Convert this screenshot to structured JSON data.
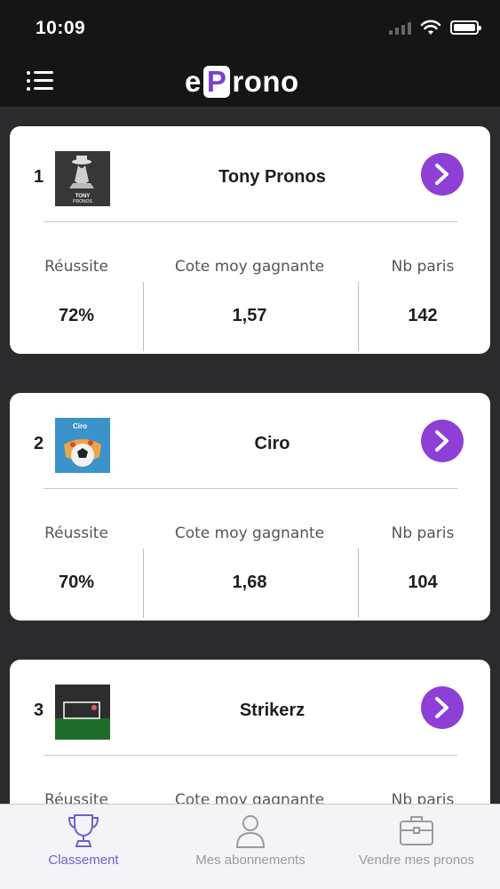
{
  "status_bar": {
    "time": "10:09"
  },
  "header": {
    "logo_prefix": "e",
    "logo_highlight": "P",
    "logo_suffix": "rono",
    "accent_color": "#7d3fd0"
  },
  "ranking": {
    "labels": {
      "success": "Réussite",
      "avg_odds": "Cote moy gagnante",
      "bets_count": "Nb paris"
    },
    "entries": [
      {
        "rank": "1",
        "name": "Tony Pronos",
        "success": "72%",
        "avg_odds": "1,57",
        "bets_count": "142",
        "avatar_text": "TONY PRONOS"
      },
      {
        "rank": "2",
        "name": "Ciro",
        "success": "70%",
        "avg_odds": "1,68",
        "bets_count": "104",
        "avatar_text": "Ciro"
      },
      {
        "rank": "3",
        "name": "Strikerz",
        "success": "",
        "avg_odds": "",
        "bets_count": ""
      }
    ]
  },
  "tabbar": {
    "tabs": [
      {
        "label": "Classement",
        "icon": "trophy-icon",
        "active": true
      },
      {
        "label": "Mes abonnements",
        "icon": "person-icon",
        "active": false
      },
      {
        "label": "Vendre mes pronos",
        "icon": "briefcase-icon",
        "active": false
      }
    ]
  }
}
